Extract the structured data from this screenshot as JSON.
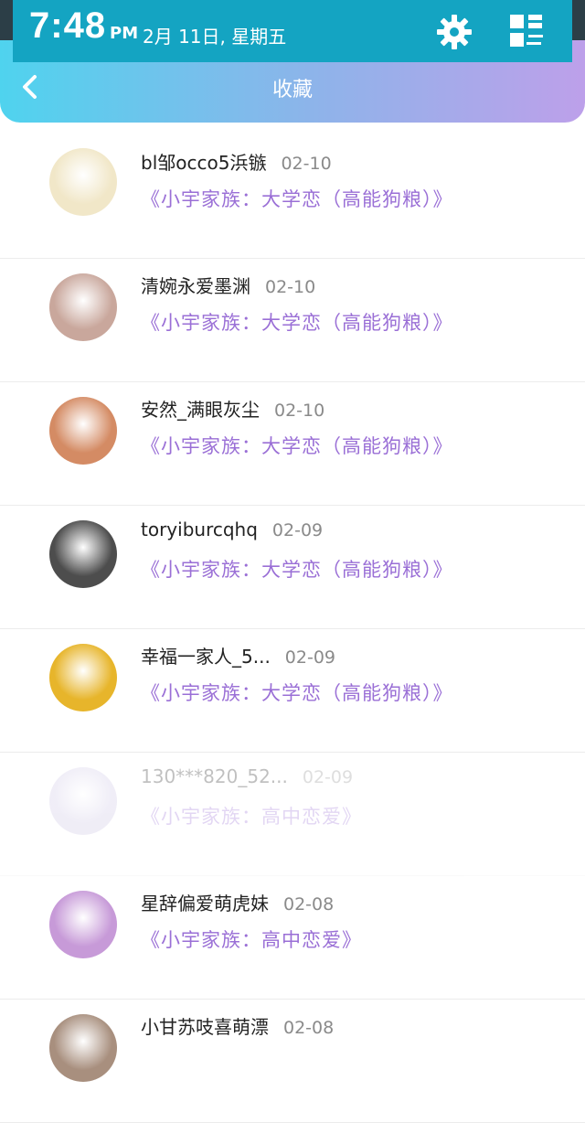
{
  "status_bar": {
    "time": "7:48",
    "ampm": "PM",
    "date": "2月 11日, 星期五"
  },
  "header": {
    "title": "收藏"
  },
  "colors": {
    "accent_gradient_start": "#4fd3ee",
    "accent_gradient_end": "#bda0ea",
    "work_link": "#9a6fd6",
    "status_bar": "#14a4c2"
  },
  "icons": {
    "settings": "gear-icon",
    "quick_toggle": "grid-toggle-icon",
    "back": "back-chevron-icon"
  },
  "items": [
    {
      "name": "bl邹occo5浜镞",
      "date": "02-10",
      "work": "《小宇家族：大学恋（高能狗粮）》",
      "avatar_color": "#f1e7c8"
    },
    {
      "name": "清婉永爱墨渊",
      "date": "02-10",
      "work": "《小宇家族：大学恋（高能狗粮）》",
      "avatar_color": "#c9a79c"
    },
    {
      "name": "安然_满眼灰尘",
      "date": "02-10",
      "work": "《小宇家族：大学恋（高能狗粮）》",
      "avatar_color": "#d48b64"
    },
    {
      "name": "toryiburcqhq",
      "date": "02-09",
      "work": "《小宇家族：大学恋（高能狗粮）》",
      "avatar_color": "#4d4d4d"
    },
    {
      "name": "幸福一家人_5...",
      "date": "02-09",
      "work": "《小宇家族：大学恋（高能狗粮）》",
      "avatar_color": "#e7b52b"
    },
    {
      "name": "130***820_52...",
      "date": "02-09",
      "work": "《小宇家族：高中恋爱》",
      "avatar_color": "#c8c0e2"
    },
    {
      "name": "星辞偏爱萌虎妹",
      "date": "02-08",
      "work": "《小宇家族：高中恋爱》",
      "avatar_color": "#c79ad8"
    },
    {
      "name": "小甘苏吱喜萌漂",
      "date": "02-08",
      "work": "",
      "avatar_color": "#a88f7e"
    }
  ]
}
